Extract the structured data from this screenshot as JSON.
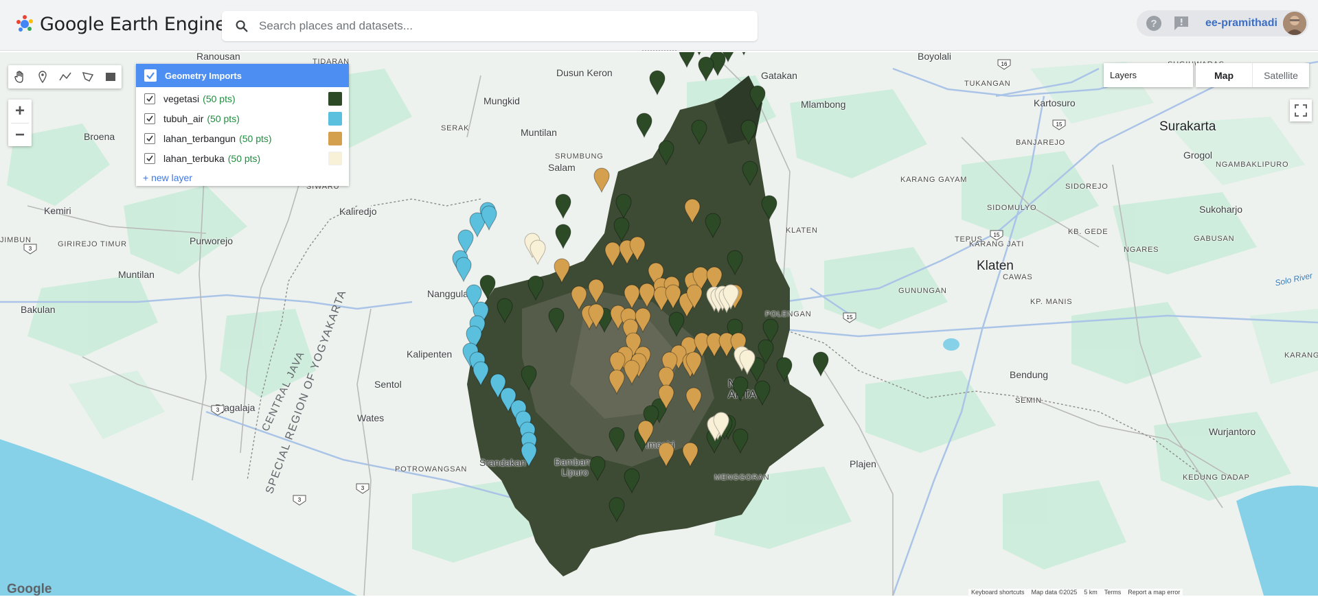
{
  "app": {
    "title": "Google Earth Engine"
  },
  "search": {
    "placeholder": "Search places and datasets..."
  },
  "user": {
    "name": "ee-pramithadi"
  },
  "tools": [
    {
      "name": "pan-hand-icon"
    },
    {
      "name": "add-marker-icon"
    },
    {
      "name": "draw-line-icon"
    },
    {
      "name": "draw-shape-icon"
    },
    {
      "name": "draw-rectangle-icon"
    }
  ],
  "zoom": {
    "in": "+",
    "out": "−"
  },
  "geometry_imports": {
    "title": "Geometry Imports",
    "layers": [
      {
        "name": "vegetasi",
        "count": "(50 pts)",
        "color": "#2b4a25"
      },
      {
        "name": "tubuh_air",
        "count": "(50 pts)",
        "color": "#5bc0de"
      },
      {
        "name": "lahan_terbangun",
        "count": "(50 pts)",
        "color": "#d4a04e"
      },
      {
        "name": "lahan_terbuka",
        "count": "(50 pts)",
        "color": "#f8f1d8"
      }
    ],
    "new_layer": "+ new layer"
  },
  "map_controls": {
    "layers_label": "Layers",
    "map_label": "Map",
    "satellite_label": "Satellite"
  },
  "map_labels": {
    "ranousan": "Ranousan",
    "tidaran": "TIDARAN",
    "dusun_keron": "Dusun Keron",
    "gatakan": "Gatakan",
    "boyolali": "Boyolali",
    "sugihwaras": "SUGIHWARAS",
    "tukangan": "TUKANGAN",
    "kartosuro": "Kartosuro",
    "mungkid": "Mungkid",
    "serak": "SERAK",
    "muntilan_top": "Muntilan",
    "mlambong": "Mlambong",
    "surakarta": "Surakarta",
    "grogol": "Grogol",
    "broena": "Broena",
    "srumbung": "SRUMBUNG",
    "salam": "Salam",
    "banjarejo": "BANJAREJO",
    "ngambaklipuro": "NGAMBAKLIPURO",
    "siwaru": "SIWARU",
    "karang_gayam": "KARANG GAYAM",
    "sidorejo": "SIDOREJO",
    "sidomulyo": "SIDOMULYO",
    "tepus": "TEPUS",
    "kb_gede": "KB. GEDE",
    "gabusan": "GABUSAN",
    "kemiri": "Kemiri",
    "kaliredjo": "Kaliredjo",
    "ngares": "NGARES",
    "sukoharjo": "Sukoharjo",
    "klaten_small": "KLATEN",
    "girirejo_timur": "GIRIREJO TIMUR",
    "purworejo": "Purworejo",
    "karang_jati": "KARANG JATI",
    "jimbun": "JIMBUN",
    "klaten": "Klaten",
    "cawas": "CAWAS",
    "muntilan_mid": "Muntilan",
    "solo_river": "Solo River",
    "nanggula": "Nanggula",
    "gunungan": "GUNUNGAN",
    "kp_manis": "KP. MANIS",
    "bakulan": "Bakulan",
    "polengan": "POLENGAN",
    "kalipenten": "Kalipenten",
    "karang": "KARANG",
    "bendung": "Bendung",
    "sentol": "Sentol",
    "semin": "SEMIN",
    "djagalaja": "Djagalaja",
    "wates": "Wates",
    "n_arta": "N\nARTA",
    "wurjantoro": "Wurjantoro",
    "imogiri": "Imogiri",
    "srandakan": "Srandakan",
    "bambang_lipuro": "Bambang\nLipuro",
    "potrowangsan": "POTROWANGSAN",
    "plajen": "Plajen",
    "menggoran": "MENGGORAN",
    "kedung_dadap": "KEDUNG DADAP",
    "central_java": "CENTRAL JAVA",
    "special_region": "SPECIAL REGION OF YOGYAKARTA"
  },
  "road_numbers": [
    "16",
    "15",
    "15",
    "15",
    "15",
    "3",
    "3",
    "3",
    "3"
  ],
  "attribution": {
    "google": "Google",
    "shortcuts": "Keyboard shortcuts",
    "map_data": "Map data ©2025",
    "scale": "5 km",
    "terms": "Terms",
    "report": "Report a map error"
  }
}
